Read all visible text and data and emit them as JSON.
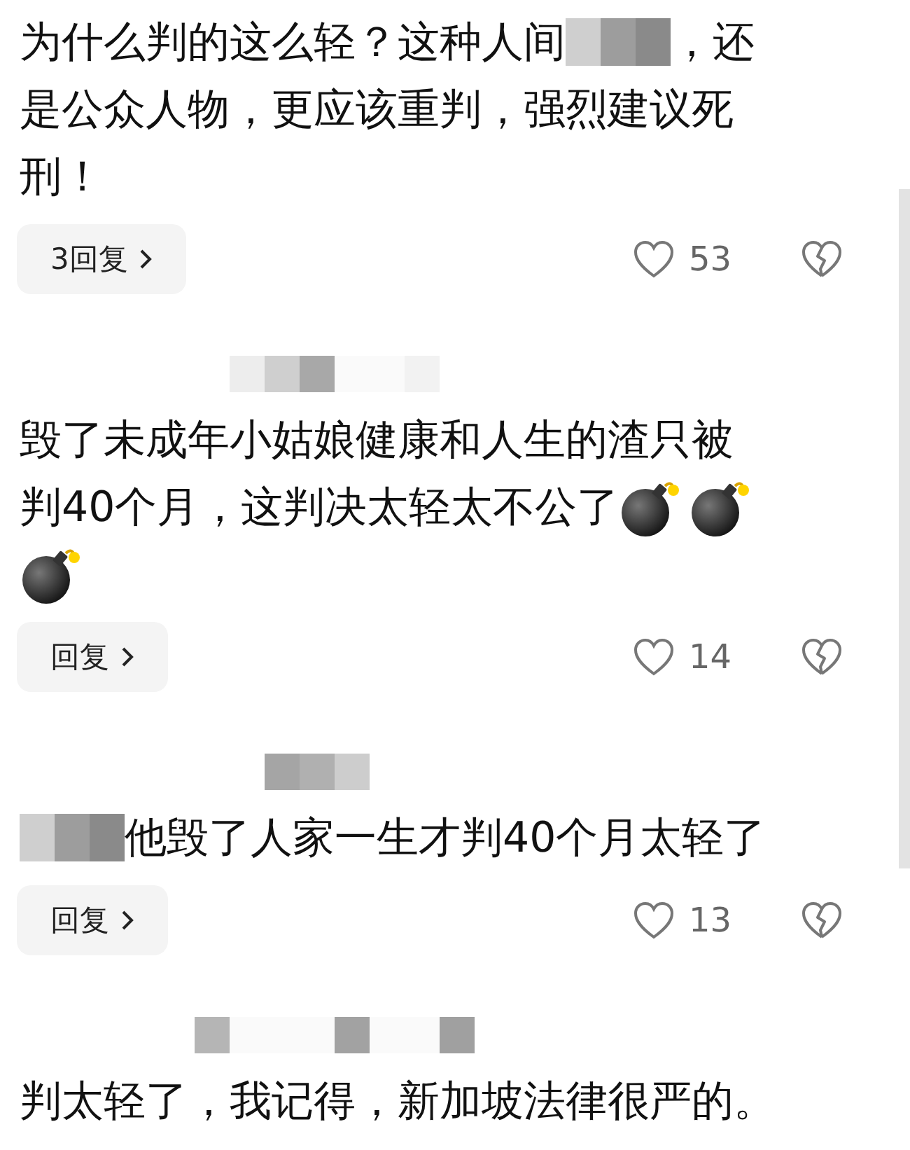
{
  "comments": [
    {
      "lines": [
        [
          {
            "kind": "text",
            "text": "为什么判的这么轻？这种人间"
          },
          {
            "kind": "mosaic"
          },
          {
            "kind": "text",
            "text": "，还"
          }
        ],
        [
          {
            "kind": "text",
            "text": "是公众人物，更应该重判，强烈建议死"
          }
        ],
        [
          {
            "kind": "text",
            "text": "刑！"
          }
        ]
      ],
      "reply": "3回复",
      "likes": "53",
      "liked": false,
      "disliked": false
    },
    {
      "author_hidden": true,
      "lines": [
        [
          {
            "kind": "text",
            "text": "毁了未成年小姑娘健康和人生的渣只被"
          }
        ],
        [
          {
            "kind": "text",
            "text": "判40个月，这判决太轻太不公了"
          },
          {
            "kind": "emoji"
          },
          {
            "kind": "emoji"
          }
        ],
        [
          {
            "kind": "emoji"
          }
        ]
      ],
      "reply": "回复",
      "likes": "14",
      "liked": false,
      "disliked": false
    },
    {
      "author_hidden": true,
      "lines": [
        [
          {
            "kind": "mosaic"
          },
          {
            "kind": "text",
            "text": "他毁了人家一生才判40个月太轻了"
          }
        ]
      ],
      "reply": "回复",
      "likes": "13",
      "liked": false,
      "disliked": false
    },
    {
      "author_hidden": true,
      "lines": [
        [
          {
            "kind": "text",
            "text": "判太轻了，我记得，新加坡法律很严的。"
          }
        ]
      ]
    }
  ]
}
